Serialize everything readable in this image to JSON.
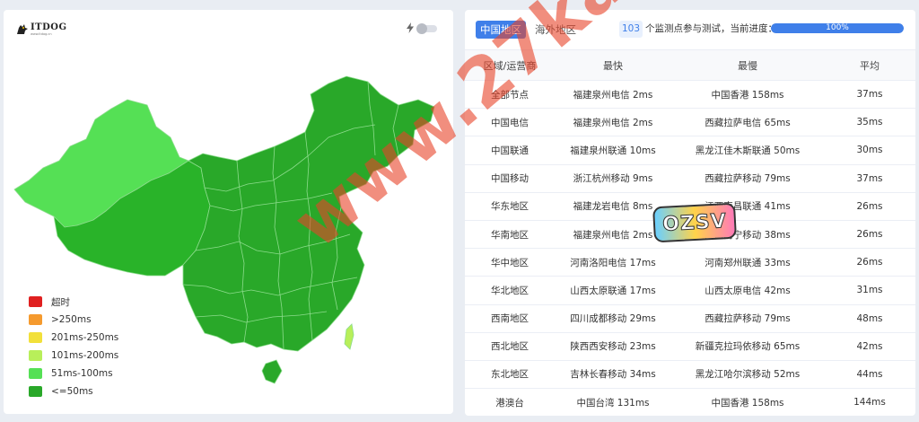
{
  "logo": {
    "text": "ITDOG",
    "subtext": "www.itdog.cn"
  },
  "map": {
    "colors": {
      "xinjiang": "#55e055",
      "tibet_qinghai_west": "#29b329",
      "default_region": "#29a829",
      "taiwan": "#b8ef5a"
    },
    "border_color": "#8cdc8c"
  },
  "legend": [
    {
      "label": "超时",
      "color": "#e02020"
    },
    {
      "label": ">250ms",
      "color": "#f59a2e"
    },
    {
      "label": "201ms-250ms",
      "color": "#f2e03a"
    },
    {
      "label": "101ms-200ms",
      "color": "#b8ef5a"
    },
    {
      "label": "51ms-100ms",
      "color": "#55e055"
    },
    {
      "label": "<=50ms",
      "color": "#29a829"
    }
  ],
  "tabs": {
    "china": "中国地区",
    "overseas": "海外地区"
  },
  "monitor": {
    "count": "103",
    "progress_label": "个监测点参与测试，当前进度：",
    "progress_text": "100%",
    "progress_value": 100
  },
  "table": {
    "headers": [
      "区域/运营商",
      "最快",
      "最慢",
      "平均"
    ],
    "rows": [
      [
        "全部节点",
        "福建泉州电信 2ms",
        "中国香港 158ms",
        "37ms"
      ],
      [
        "中国电信",
        "福建泉州电信 2ms",
        "西藏拉萨电信 65ms",
        "35ms"
      ],
      [
        "中国联通",
        "福建泉州联通 10ms",
        "黑龙江佳木斯联通 50ms",
        "30ms"
      ],
      [
        "中国移动",
        "浙江杭州移动 9ms",
        "西藏拉萨移动 79ms",
        "37ms"
      ],
      [
        "华东地区",
        "福建龙岩电信 8ms",
        "江西南昌联通 41ms",
        "26ms"
      ],
      [
        "华南地区",
        "福建泉州电信 2ms",
        "广西南宁移动 38ms",
        "26ms"
      ],
      [
        "华中地区",
        "河南洛阳电信 17ms",
        "河南郑州联通 33ms",
        "26ms"
      ],
      [
        "华北地区",
        "山西太原联通 17ms",
        "山西太原电信 42ms",
        "31ms"
      ],
      [
        "西南地区",
        "四川成都移动 29ms",
        "西藏拉萨移动 79ms",
        "48ms"
      ],
      [
        "西北地区",
        "陕西西安移动 23ms",
        "新疆克拉玛依移动 65ms",
        "42ms"
      ],
      [
        "东北地区",
        "吉林长春移动 34ms",
        "黑龙江哈尔滨移动 52ms",
        "44ms"
      ],
      [
        "港澳台",
        "中国台湾 131ms",
        "中国香港 158ms",
        "144ms"
      ]
    ]
  },
  "watermarks": {
    "site": "www.27ka.cn",
    "badge": "OZSV"
  }
}
